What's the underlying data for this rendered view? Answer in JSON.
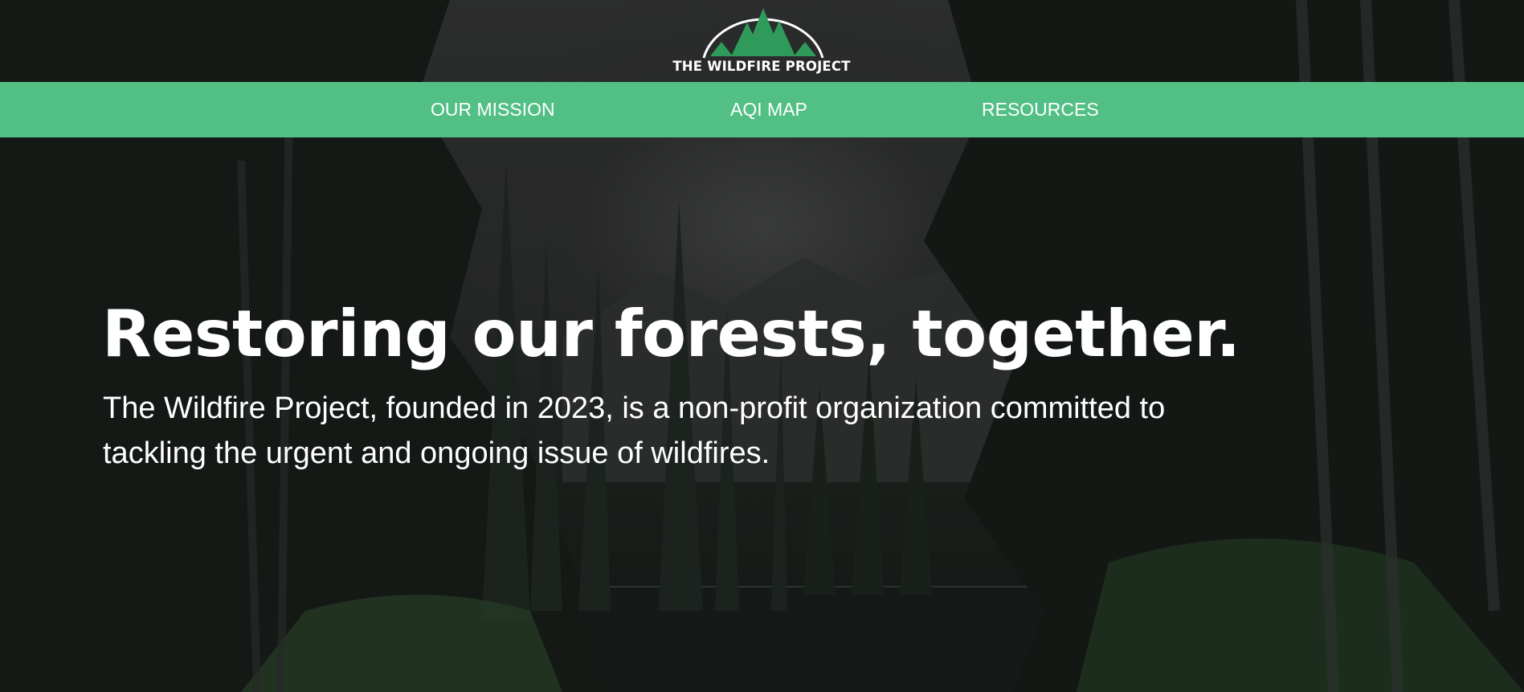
{
  "header": {
    "logo_text": "THE WILDFIRE PROJECT",
    "logo_icon": "pine-trees-icon"
  },
  "nav": {
    "items": [
      {
        "label": "OUR MISSION"
      },
      {
        "label": "AQI MAP"
      },
      {
        "label": "RESOURCES"
      }
    ]
  },
  "hero": {
    "title": "Restoring our forests, together.",
    "description": "The Wildfire Project, founded in 2023, is a non-profit organization committed to tackling the urgent and ongoing issue of wildfires.",
    "background": "forest-lake-photo"
  },
  "colors": {
    "nav_background": "#52bf84",
    "logo_green": "#2f9a5a",
    "text": "#ffffff"
  }
}
